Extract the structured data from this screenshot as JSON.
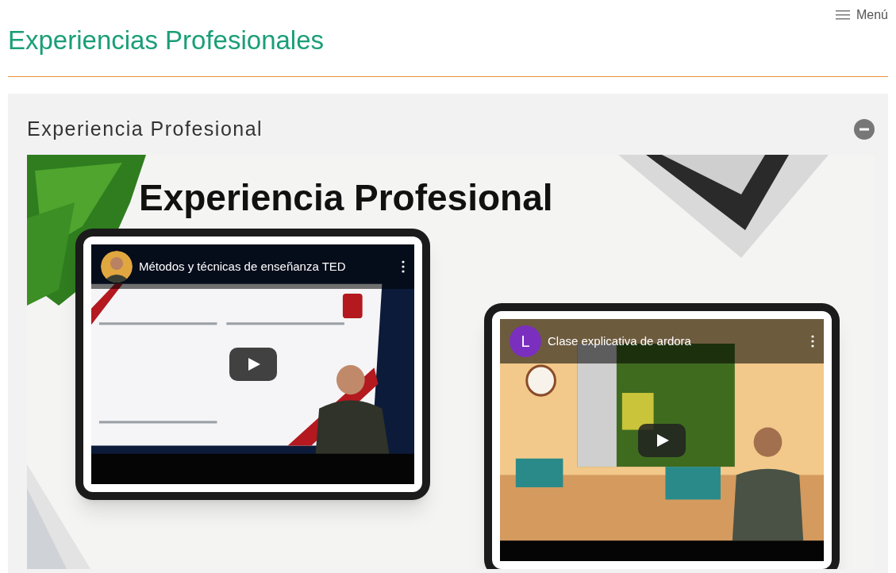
{
  "header": {
    "title": "Experiencias Profesionales",
    "menu": "Menú"
  },
  "section": {
    "title": "Experiencia Profesional",
    "expanded": true,
    "banner": {
      "title": "Experiencia Profesional",
      "videos": [
        {
          "title": "Métodos y técnicas de enseñanza TED",
          "scene": {
            "kind": "slide"
          }
        },
        {
          "title": "Clase explicativa de ardora",
          "avatar": {
            "kind": "letter",
            "letter": "L"
          },
          "scene": {
            "kind": "classroom"
          }
        }
      ]
    }
  }
}
